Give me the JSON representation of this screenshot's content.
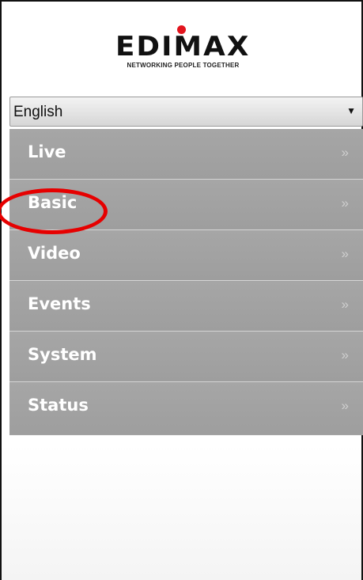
{
  "brand": {
    "logo_text": "EDIMAX",
    "tagline": "NETWORKING PEOPLE TOGETHER",
    "dot_color": "#e2141d"
  },
  "language": {
    "selected": "English",
    "arrow_icon": "dropdown-arrow-icon"
  },
  "menu": {
    "items": [
      {
        "label": "Live",
        "chevron": "»"
      },
      {
        "label": "Basic",
        "chevron": "»"
      },
      {
        "label": "Video",
        "chevron": "»"
      },
      {
        "label": "Events",
        "chevron": "»"
      },
      {
        "label": "System",
        "chevron": "»"
      },
      {
        "label": "Status",
        "chevron": "»"
      }
    ],
    "background": "#a3a3a3",
    "text_color": "#ffffff"
  },
  "annotation": {
    "highlight_target": "Basic",
    "highlight_color": "#e60000"
  }
}
